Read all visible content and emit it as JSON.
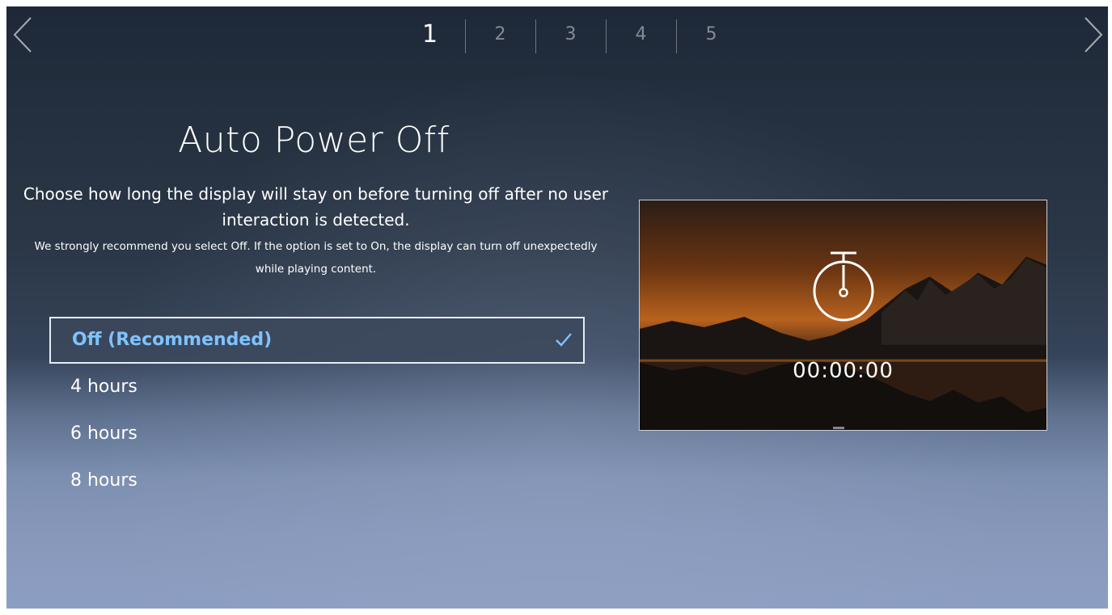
{
  "nav": {
    "prev_icon": "chevron-left-icon",
    "next_icon": "chevron-right-icon",
    "steps": [
      "1",
      "2",
      "3",
      "4",
      "5"
    ],
    "active_step": "1"
  },
  "main": {
    "title": "Auto Power Off",
    "description": "Choose how long the display will stay on before turning off after no user interaction is detected.",
    "note": "We strongly recommend you select Off. If the option is set to On, the display can turn off unexpectedly while playing content."
  },
  "options": {
    "items": [
      {
        "label": "Off (Recommended)",
        "selected": true
      },
      {
        "label": "4 hours",
        "selected": false
      },
      {
        "label": "6 hours",
        "selected": false
      },
      {
        "label": "8 hours",
        "selected": false
      }
    ],
    "check_icon": "checkmark-icon"
  },
  "preview": {
    "icon": "timer-icon",
    "time": "00:00:00"
  },
  "colors": {
    "selected_text": "#7ec3ff",
    "text": "#ffffff"
  }
}
